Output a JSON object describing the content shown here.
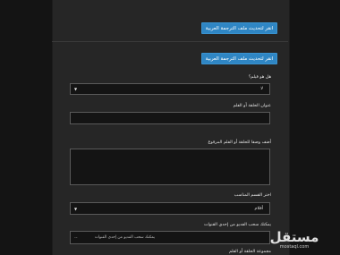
{
  "form": {
    "update_button_1": "انقر لتحديث ملف الترجمة العربية",
    "update_button_2": "انقر لتحديث ملف الترجمة العربية",
    "rating_label": "هل هو فيلم؟",
    "rating_value": "لا",
    "title_label": "عنوان الحلقة أو الفلم",
    "title_value": "",
    "description_label": "أضف وصفا للحلقة أو الفلم المرفوع",
    "description_value": "",
    "section_label": "اختر القسم المناسب",
    "section_value": "أفلام",
    "video_label": "يمكنك سحب الفديو من إحدى القنوات",
    "video_placeholder": "يمكنك سحب الفديو من إحدى القنوات",
    "video_dash": "--",
    "next_label": "مجموعة الحلقة أو الفلم"
  },
  "watermark": {
    "main": "مستقل",
    "sub": "mostaql.com"
  },
  "colors": {
    "page_bg": "#141414",
    "panel_bg": "#262626",
    "button_bg": "#2f86c4"
  }
}
